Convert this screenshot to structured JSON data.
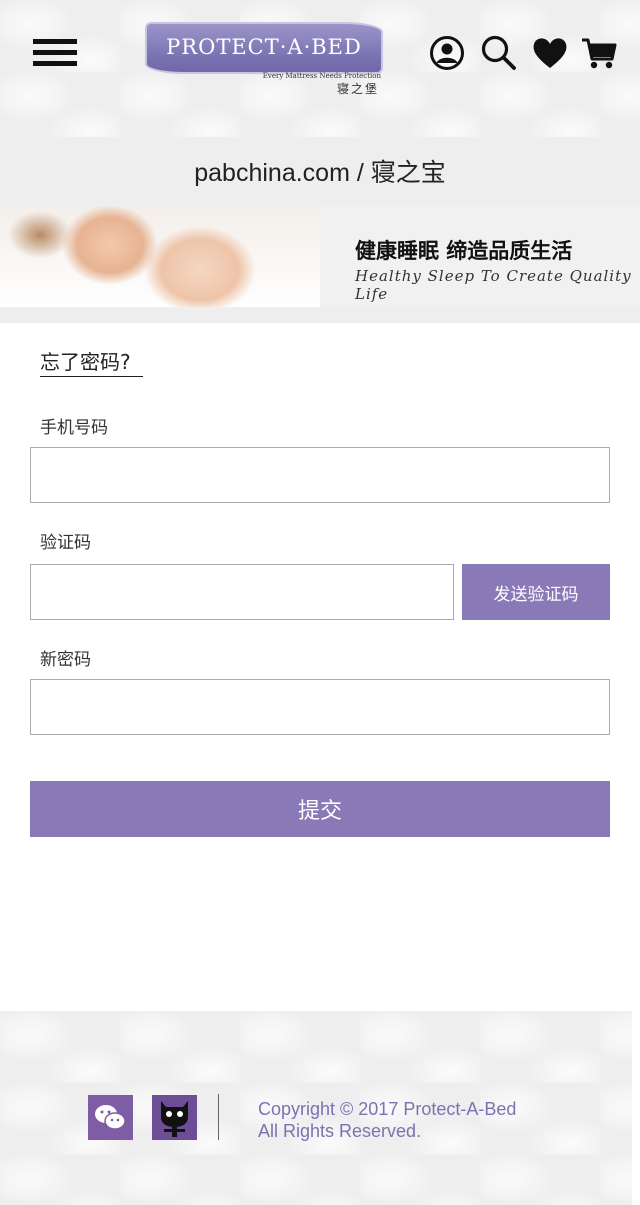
{
  "header": {
    "logo": {
      "brand": "PROTECT·A·BED",
      "tagline": "Every Mattress Needs Protection",
      "cn_name": "寝之堡"
    },
    "icons": [
      "menu-icon",
      "account-icon",
      "search-icon",
      "heart-icon",
      "cart-icon"
    ]
  },
  "domain_bar": {
    "text": "pabchina.com / 寝之宝"
  },
  "banner": {
    "cn_text": "健康睡眠  缔造品质生活",
    "en_text": "Healthy Sleep To Create Quality Life"
  },
  "form": {
    "title": "忘了密码?",
    "phone_label": "手机号码",
    "phone_value": "",
    "code_label": "验证码",
    "code_value": "",
    "send_code_label": "发送验证码",
    "new_password_label": "新密码",
    "new_password_value": "",
    "submit_label": "提交"
  },
  "footer": {
    "copyright_line1": "Copyright  © 2017 Protect-A-Bed",
    "copyright_line2": "All Rights Reserved.",
    "social_icons": [
      "wechat-icon",
      "tmall-icon"
    ]
  },
  "colors": {
    "accent": "#8a79b7",
    "logo_purple": "#7f77b5",
    "copyright_text": "#7e71b2",
    "strip_gray": "#eeeeee"
  }
}
